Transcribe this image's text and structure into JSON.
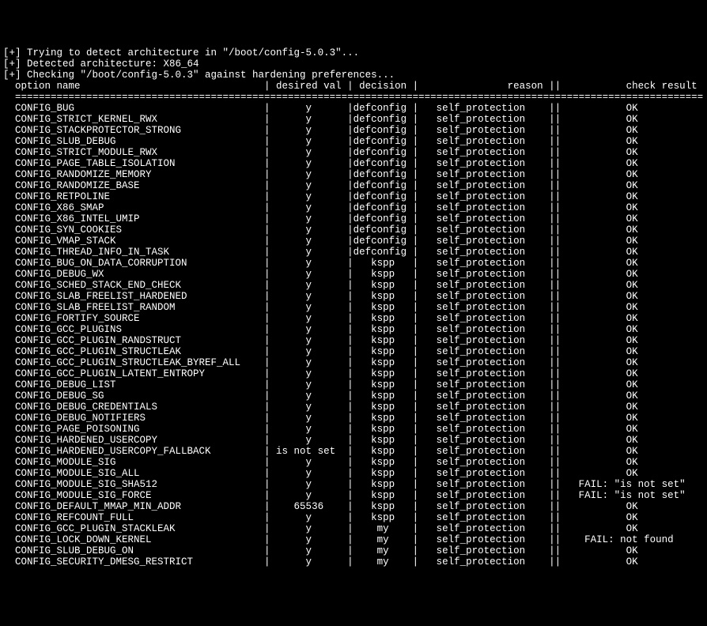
{
  "header": {
    "line1": "[+] Trying to detect architecture in \"/boot/config-5.0.3\"...",
    "line2": "[+] Detected architecture: X86_64",
    "line3": "[+] Checking \"/boot/config-5.0.3\" against hardening preferences..."
  },
  "columns": {
    "option": "option name",
    "desired": "desired val",
    "decision": "decision",
    "reason": "reason",
    "result": "check result"
  },
  "rows": [
    {
      "option": "CONFIG_BUG",
      "desired": "y",
      "decision": "defconfig",
      "reason": "self_protection",
      "result": "OK"
    },
    {
      "option": "CONFIG_STRICT_KERNEL_RWX",
      "desired": "y",
      "decision": "defconfig",
      "reason": "self_protection",
      "result": "OK"
    },
    {
      "option": "CONFIG_STACKPROTECTOR_STRONG",
      "desired": "y",
      "decision": "defconfig",
      "reason": "self_protection",
      "result": "OK"
    },
    {
      "option": "CONFIG_SLUB_DEBUG",
      "desired": "y",
      "decision": "defconfig",
      "reason": "self_protection",
      "result": "OK"
    },
    {
      "option": "CONFIG_STRICT_MODULE_RWX",
      "desired": "y",
      "decision": "defconfig",
      "reason": "self_protection",
      "result": "OK"
    },
    {
      "option": "CONFIG_PAGE_TABLE_ISOLATION",
      "desired": "y",
      "decision": "defconfig",
      "reason": "self_protection",
      "result": "OK"
    },
    {
      "option": "CONFIG_RANDOMIZE_MEMORY",
      "desired": "y",
      "decision": "defconfig",
      "reason": "self_protection",
      "result": "OK"
    },
    {
      "option": "CONFIG_RANDOMIZE_BASE",
      "desired": "y",
      "decision": "defconfig",
      "reason": "self_protection",
      "result": "OK"
    },
    {
      "option": "CONFIG_RETPOLINE",
      "desired": "y",
      "decision": "defconfig",
      "reason": "self_protection",
      "result": "OK"
    },
    {
      "option": "CONFIG_X86_SMAP",
      "desired": "y",
      "decision": "defconfig",
      "reason": "self_protection",
      "result": "OK"
    },
    {
      "option": "CONFIG_X86_INTEL_UMIP",
      "desired": "y",
      "decision": "defconfig",
      "reason": "self_protection",
      "result": "OK"
    },
    {
      "option": "CONFIG_SYN_COOKIES",
      "desired": "y",
      "decision": "defconfig",
      "reason": "self_protection",
      "result": "OK"
    },
    {
      "option": "CONFIG_VMAP_STACK",
      "desired": "y",
      "decision": "defconfig",
      "reason": "self_protection",
      "result": "OK"
    },
    {
      "option": "CONFIG_THREAD_INFO_IN_TASK",
      "desired": "y",
      "decision": "defconfig",
      "reason": "self_protection",
      "result": "OK"
    },
    {
      "option": "CONFIG_BUG_ON_DATA_CORRUPTION",
      "desired": "y",
      "decision": "kspp",
      "reason": "self_protection",
      "result": "OK"
    },
    {
      "option": "CONFIG_DEBUG_WX",
      "desired": "y",
      "decision": "kspp",
      "reason": "self_protection",
      "result": "OK"
    },
    {
      "option": "CONFIG_SCHED_STACK_END_CHECK",
      "desired": "y",
      "decision": "kspp",
      "reason": "self_protection",
      "result": "OK"
    },
    {
      "option": "CONFIG_SLAB_FREELIST_HARDENED",
      "desired": "y",
      "decision": "kspp",
      "reason": "self_protection",
      "result": "OK"
    },
    {
      "option": "CONFIG_SLAB_FREELIST_RANDOM",
      "desired": "y",
      "decision": "kspp",
      "reason": "self_protection",
      "result": "OK"
    },
    {
      "option": "CONFIG_FORTIFY_SOURCE",
      "desired": "y",
      "decision": "kspp",
      "reason": "self_protection",
      "result": "OK"
    },
    {
      "option": "CONFIG_GCC_PLUGINS",
      "desired": "y",
      "decision": "kspp",
      "reason": "self_protection",
      "result": "OK"
    },
    {
      "option": "CONFIG_GCC_PLUGIN_RANDSTRUCT",
      "desired": "y",
      "decision": "kspp",
      "reason": "self_protection",
      "result": "OK"
    },
    {
      "option": "CONFIG_GCC_PLUGIN_STRUCTLEAK",
      "desired": "y",
      "decision": "kspp",
      "reason": "self_protection",
      "result": "OK"
    },
    {
      "option": "CONFIG_GCC_PLUGIN_STRUCTLEAK_BYREF_ALL",
      "desired": "y",
      "decision": "kspp",
      "reason": "self_protection",
      "result": "OK"
    },
    {
      "option": "CONFIG_GCC_PLUGIN_LATENT_ENTROPY",
      "desired": "y",
      "decision": "kspp",
      "reason": "self_protection",
      "result": "OK"
    },
    {
      "option": "CONFIG_DEBUG_LIST",
      "desired": "y",
      "decision": "kspp",
      "reason": "self_protection",
      "result": "OK"
    },
    {
      "option": "CONFIG_DEBUG_SG",
      "desired": "y",
      "decision": "kspp",
      "reason": "self_protection",
      "result": "OK"
    },
    {
      "option": "CONFIG_DEBUG_CREDENTIALS",
      "desired": "y",
      "decision": "kspp",
      "reason": "self_protection",
      "result": "OK"
    },
    {
      "option": "CONFIG_DEBUG_NOTIFIERS",
      "desired": "y",
      "decision": "kspp",
      "reason": "self_protection",
      "result": "OK"
    },
    {
      "option": "CONFIG_PAGE_POISONING",
      "desired": "y",
      "decision": "kspp",
      "reason": "self_protection",
      "result": "OK"
    },
    {
      "option": "CONFIG_HARDENED_USERCOPY",
      "desired": "y",
      "decision": "kspp",
      "reason": "self_protection",
      "result": "OK"
    },
    {
      "option": "CONFIG_HARDENED_USERCOPY_FALLBACK",
      "desired": "is not set",
      "decision": "kspp",
      "reason": "self_protection",
      "result": "OK"
    },
    {
      "option": "CONFIG_MODULE_SIG",
      "desired": "y",
      "decision": "kspp",
      "reason": "self_protection",
      "result": "OK"
    },
    {
      "option": "CONFIG_MODULE_SIG_ALL",
      "desired": "y",
      "decision": "kspp",
      "reason": "self_protection",
      "result": "OK"
    },
    {
      "option": "CONFIG_MODULE_SIG_SHA512",
      "desired": "y",
      "decision": "kspp",
      "reason": "self_protection",
      "result": "FAIL: \"is not set\""
    },
    {
      "option": "CONFIG_MODULE_SIG_FORCE",
      "desired": "y",
      "decision": "kspp",
      "reason": "self_protection",
      "result": "FAIL: \"is not set\""
    },
    {
      "option": "CONFIG_DEFAULT_MMAP_MIN_ADDR",
      "desired": "65536",
      "decision": "kspp",
      "reason": "self_protection",
      "result": "OK"
    },
    {
      "option": "CONFIG_REFCOUNT_FULL",
      "desired": "y",
      "decision": "kspp",
      "reason": "self_protection",
      "result": "OK"
    },
    {
      "option": "CONFIG_GCC_PLUGIN_STACKLEAK",
      "desired": "y",
      "decision": "my",
      "reason": "self_protection",
      "result": "OK"
    },
    {
      "option": "CONFIG_LOCK_DOWN_KERNEL",
      "desired": "y",
      "decision": "my",
      "reason": "self_protection",
      "result": "FAIL: not found"
    },
    {
      "option": "CONFIG_SLUB_DEBUG_ON",
      "desired": "y",
      "decision": "my",
      "reason": "self_protection",
      "result": "OK"
    },
    {
      "option": "CONFIG_SECURITY_DMESG_RESTRICT",
      "desired": "y",
      "decision": "my",
      "reason": "self_protection",
      "result": "OK"
    }
  ]
}
